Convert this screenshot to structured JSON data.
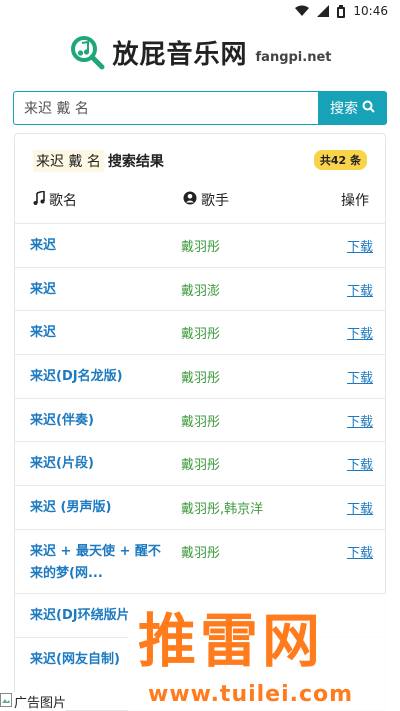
{
  "status_bar": {
    "time": "10:46"
  },
  "header": {
    "site_title": "放屁音乐网",
    "site_domain": "fangpi.net"
  },
  "search": {
    "value": "来迟 戴 名",
    "button_label": "搜索"
  },
  "results": {
    "keyword": "来迟 戴 名",
    "suffix": "搜索结果",
    "count": "共42 条",
    "columns": {
      "song": "歌名",
      "artist": "歌手",
      "op": "操作"
    },
    "rows": [
      {
        "song": "来迟",
        "artist": "戴羽彤",
        "op": "下载"
      },
      {
        "song": "来迟",
        "artist": "戴羽澎",
        "op": "下载"
      },
      {
        "song": "来迟",
        "artist": "戴羽彤",
        "op": "下载"
      },
      {
        "song": "来迟(DJ名龙版)",
        "artist": "戴羽彤",
        "op": "下载"
      },
      {
        "song": "来迟(伴奏)",
        "artist": "戴羽彤",
        "op": "下载"
      },
      {
        "song": "来迟(片段)",
        "artist": "戴羽彤",
        "op": "下载"
      },
      {
        "song": "来迟 (男声版)",
        "artist": "戴羽彤,韩京洋",
        "op": "下载"
      },
      {
        "song": "来迟 + 最天使 + 醒不来的梦(网...",
        "artist": "戴羽彤",
        "op": "下载"
      },
      {
        "song": "来迟(DJ环绕版片",
        "artist": "",
        "op": ""
      },
      {
        "song": "来迟(网友自制)",
        "artist": "",
        "op": ""
      }
    ]
  },
  "watermark": {
    "text": "推雷网",
    "url": "www.tuilei.com"
  },
  "ad": {
    "label": "广告图片"
  },
  "colors": {
    "accent": "#17a2b8",
    "link": "#1d7ac0",
    "artist": "#3f9a3f",
    "badge": "#f9d34a",
    "watermark": "#ff7b1c"
  }
}
